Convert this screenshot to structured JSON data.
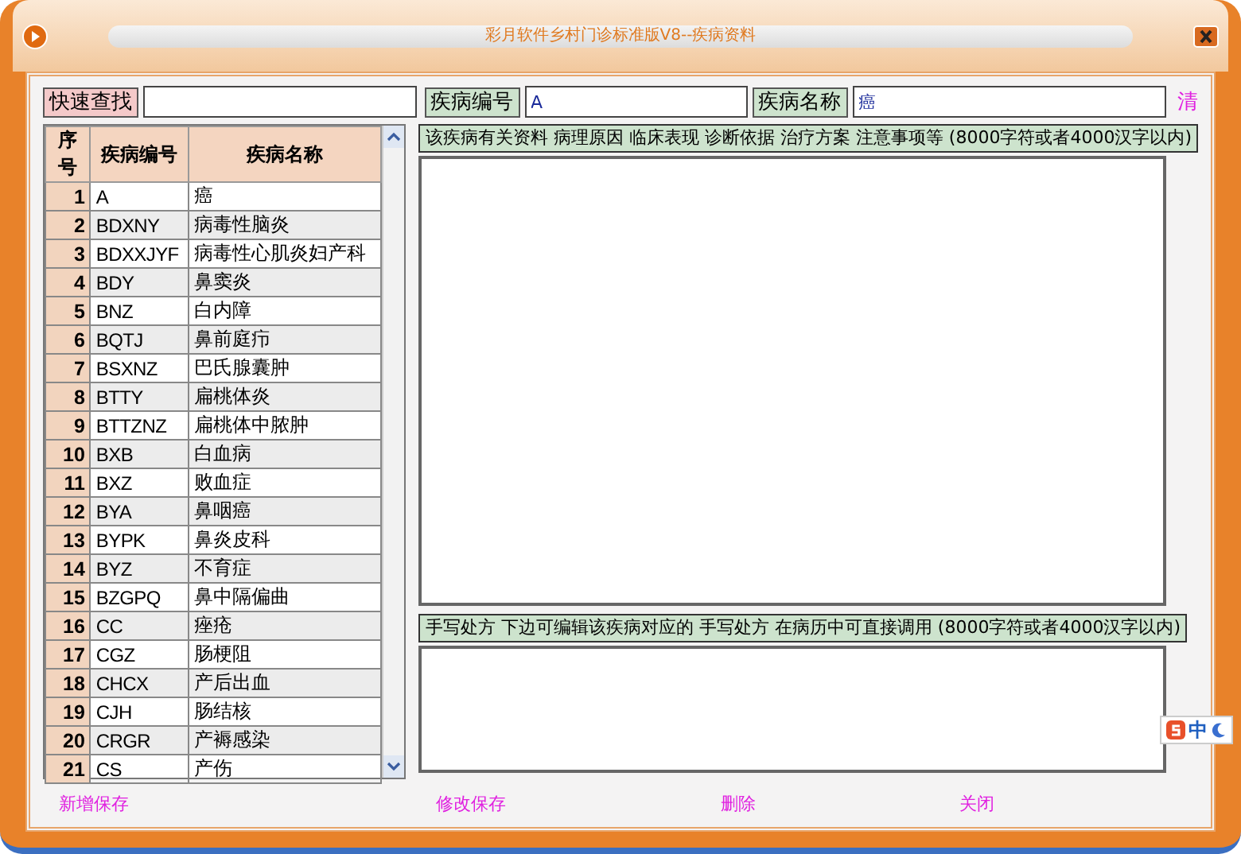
{
  "window": {
    "title": "彩月软件乡村门诊标准版V8--疾病资料"
  },
  "search": {
    "quick_label": "快速查找",
    "code_label": "疾病编号",
    "code_value": "A",
    "name_label": "疾病名称",
    "name_value": "癌",
    "clear": "清"
  },
  "table": {
    "columns": [
      "序号",
      "疾病编号",
      "疾病名称"
    ],
    "rows": [
      {
        "no": "1",
        "code": "A",
        "name": "癌"
      },
      {
        "no": "2",
        "code": "BDXNY",
        "name": "病毒性脑炎"
      },
      {
        "no": "3",
        "code": "BDXXJYF",
        "name": "病毒性心肌炎妇产科"
      },
      {
        "no": "4",
        "code": "BDY",
        "name": "鼻窦炎"
      },
      {
        "no": "5",
        "code": "BNZ",
        "name": "白内障"
      },
      {
        "no": "6",
        "code": "BQTJ",
        "name": "鼻前庭疖"
      },
      {
        "no": "7",
        "code": "BSXNZ",
        "name": "巴氏腺囊肿"
      },
      {
        "no": "8",
        "code": "BTTY",
        "name": "扁桃体炎"
      },
      {
        "no": "9",
        "code": "BTTZNZ",
        "name": "扁桃体中脓肿"
      },
      {
        "no": "10",
        "code": "BXB",
        "name": "白血病"
      },
      {
        "no": "11",
        "code": "BXZ",
        "name": "败血症"
      },
      {
        "no": "12",
        "code": "BYA",
        "name": "鼻咽癌"
      },
      {
        "no": "13",
        "code": "BYPK",
        "name": "鼻炎皮科"
      },
      {
        "no": "14",
        "code": "BYZ",
        "name": "不育症"
      },
      {
        "no": "15",
        "code": "BZGPQ",
        "name": "鼻中隔偏曲"
      },
      {
        "no": "16",
        "code": "CC",
        "name": "痤疮"
      },
      {
        "no": "17",
        "code": "CGZ",
        "name": "肠梗阻"
      },
      {
        "no": "18",
        "code": "CHCX",
        "name": "产后出血"
      },
      {
        "no": "19",
        "code": "CJH",
        "name": "肠结核"
      },
      {
        "no": "20",
        "code": "CRGR",
        "name": "产褥感染"
      },
      {
        "no": "21",
        "code": "CS",
        "name": "产伤"
      }
    ]
  },
  "details": {
    "label": "该疾病有关资料 病理原因 临床表现 诊断依据 治疗方案 注意事项等 (8000字符或者4000汉字以内)"
  },
  "prescription": {
    "label": "手写处方 下边可编辑该疾病对应的 手写处方 在病历中可直接调用 (8000字符或者4000汉字以内)"
  },
  "ime": {
    "mode": "中"
  },
  "buttons": [
    "新增保存",
    "修改保存",
    "删除",
    "关闭"
  ]
}
